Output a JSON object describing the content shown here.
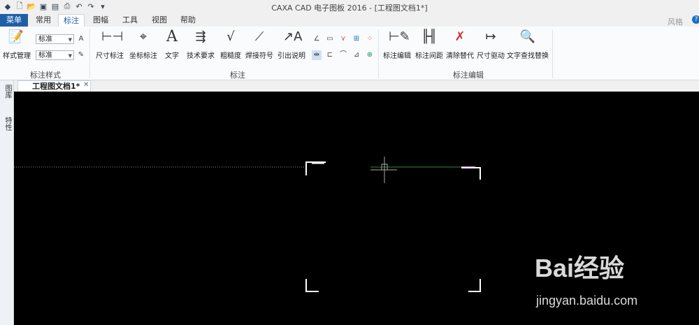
{
  "title_bar": {
    "title": "CAXA CAD 电子图板 2016 - [工程图文档1*]",
    "style_label": "风格"
  },
  "menu": {
    "label": "菜单"
  },
  "tabs": [
    "常用",
    "标注",
    "图幅",
    "工具",
    "视图",
    "帮助"
  ],
  "active_tab": "标注",
  "ribbon": {
    "groups": {
      "style": "标注样式",
      "annotate": "标注",
      "edit": "标注编辑"
    },
    "style_manager": "样式管理",
    "dropdowns": [
      "标准",
      "标准"
    ],
    "buttons": {
      "dimension": "尺寸标注",
      "coord": "坐标标注",
      "text": "文字",
      "tech_req": "技术要求",
      "roughness": "粗糙度",
      "weld": "焊接符号",
      "leader": "引出说明",
      "dim_edit": "标注编辑",
      "dim_space": "标注间距",
      "clear_override": "清除替代",
      "dim_drive": "尺寸驱动",
      "find_replace": "文字查找替换"
    }
  },
  "document": {
    "tab": "工程图文档1*"
  },
  "sidebar": {
    "items": [
      "图库",
      "特性"
    ]
  },
  "watermark": {
    "brand": "Bai经验",
    "url": "jingyan.baidu.com"
  },
  "colors": {
    "menu_bg": "#1f5fa6",
    "canvas_bg": "#000000",
    "accent_line": "#2e8b2e"
  }
}
